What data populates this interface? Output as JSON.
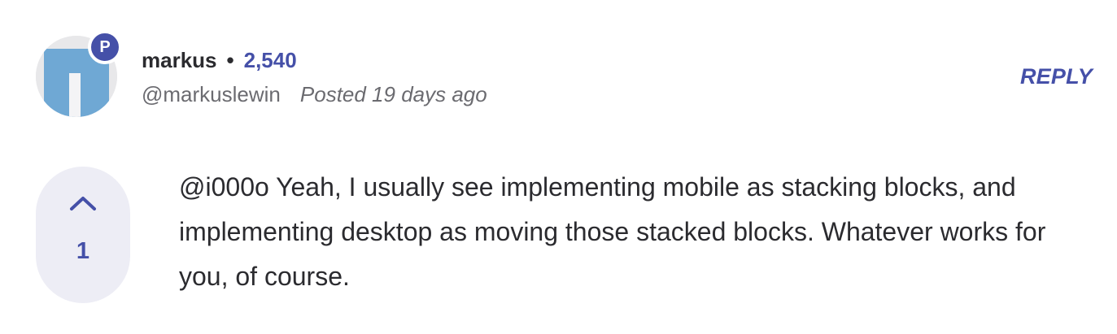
{
  "author": {
    "name": "markus",
    "separator": "•",
    "points": "2,540",
    "handle": "@markuslewin",
    "posted": "Posted 19 days ago",
    "rank_badge": "P",
    "badge_color": "#4550a8"
  },
  "actions": {
    "reply_label": "REPLY"
  },
  "votes": {
    "count": "1",
    "upvote_icon": "chevron-up-icon"
  },
  "comment": {
    "text": "@i000o Yeah, I usually see implementing mobile as stacking blocks, and implementing desktop as moving those stacked blocks. Whatever works for you, of course."
  },
  "colors": {
    "accent": "#4550a8",
    "vote_bg": "#ededf5",
    "avatar_blue": "#6fa8d4"
  }
}
